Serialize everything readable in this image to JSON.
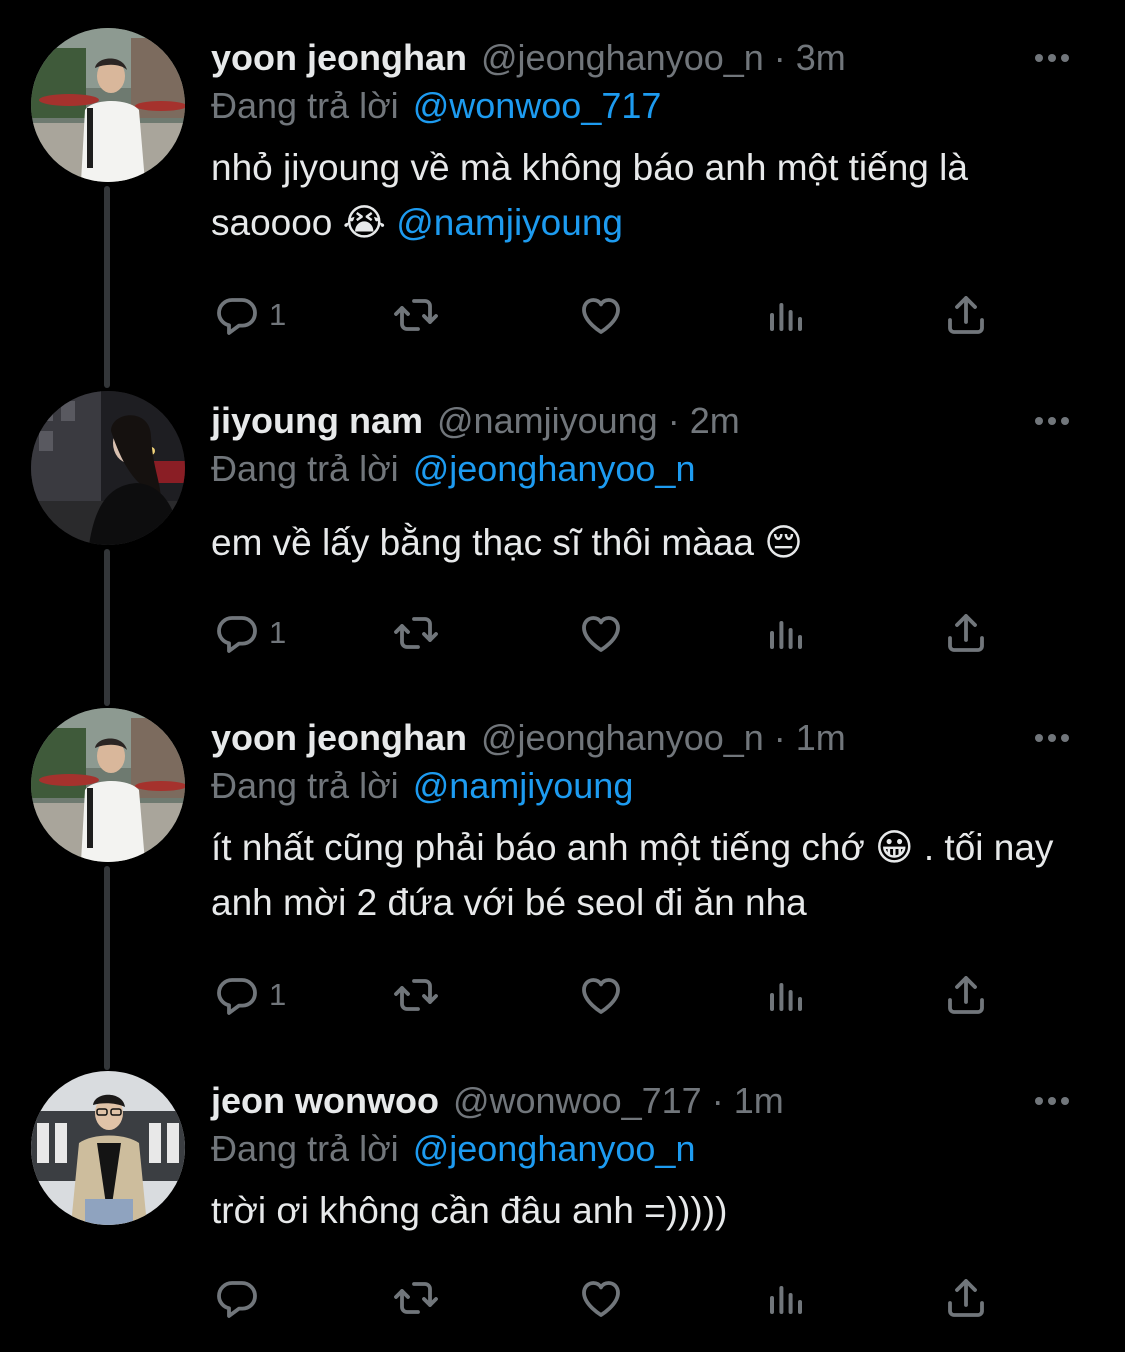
{
  "colors": {
    "background": "#000000",
    "text_primary": "#e7e9ea",
    "text_secondary": "#71767b",
    "link": "#1d9bf0",
    "thread_line": "#333639"
  },
  "labels": {
    "replying_to": "Đang trả lời"
  },
  "tweets": [
    {
      "name": "yoon jeonghan",
      "handle": "@jeonghanyoo_n",
      "separator": "·",
      "time": "3m",
      "reply_to": "@wonwoo_717",
      "text": "nhỏ jiyoung về mà không báo anh một tiếng là saoooo",
      "emoji": "😭",
      "mention": "@namjiyoung",
      "reply_count": "1",
      "avatar_icon": "profile-photo-man-white-shirt"
    },
    {
      "name": "jiyoung nam",
      "handle": "@namjiyoung",
      "separator": "·",
      "time": "2m",
      "reply_to": "@jeonghanyoo_n",
      "text": "em về lấy bằng thạc sĩ thôi màaa",
      "emoji": "😔",
      "reply_count": "1",
      "avatar_icon": "profile-photo-woman-night-street"
    },
    {
      "name": "yoon jeonghan",
      "handle": "@jeonghanyoo_n",
      "separator": "·",
      "time": "1m",
      "reply_to": "@namjiyoung",
      "text_before": "ít nhất cũng phải báo anh một tiếng chớ",
      "emoji": "😀",
      "text_after": ". tối nay anh mời 2 đứa với bé seol đi ăn nha",
      "reply_count": "1",
      "avatar_icon": "profile-photo-man-white-shirt"
    },
    {
      "name": "jeon wonwoo",
      "handle": "@wonwoo_717",
      "separator": "·",
      "time": "1m",
      "reply_to": "@jeonghanyoo_n",
      "text": "trời ơi không cần đâu anh =)))))",
      "reply_count": "",
      "avatar_icon": "profile-photo-man-glasses-beige-jacket"
    }
  ]
}
